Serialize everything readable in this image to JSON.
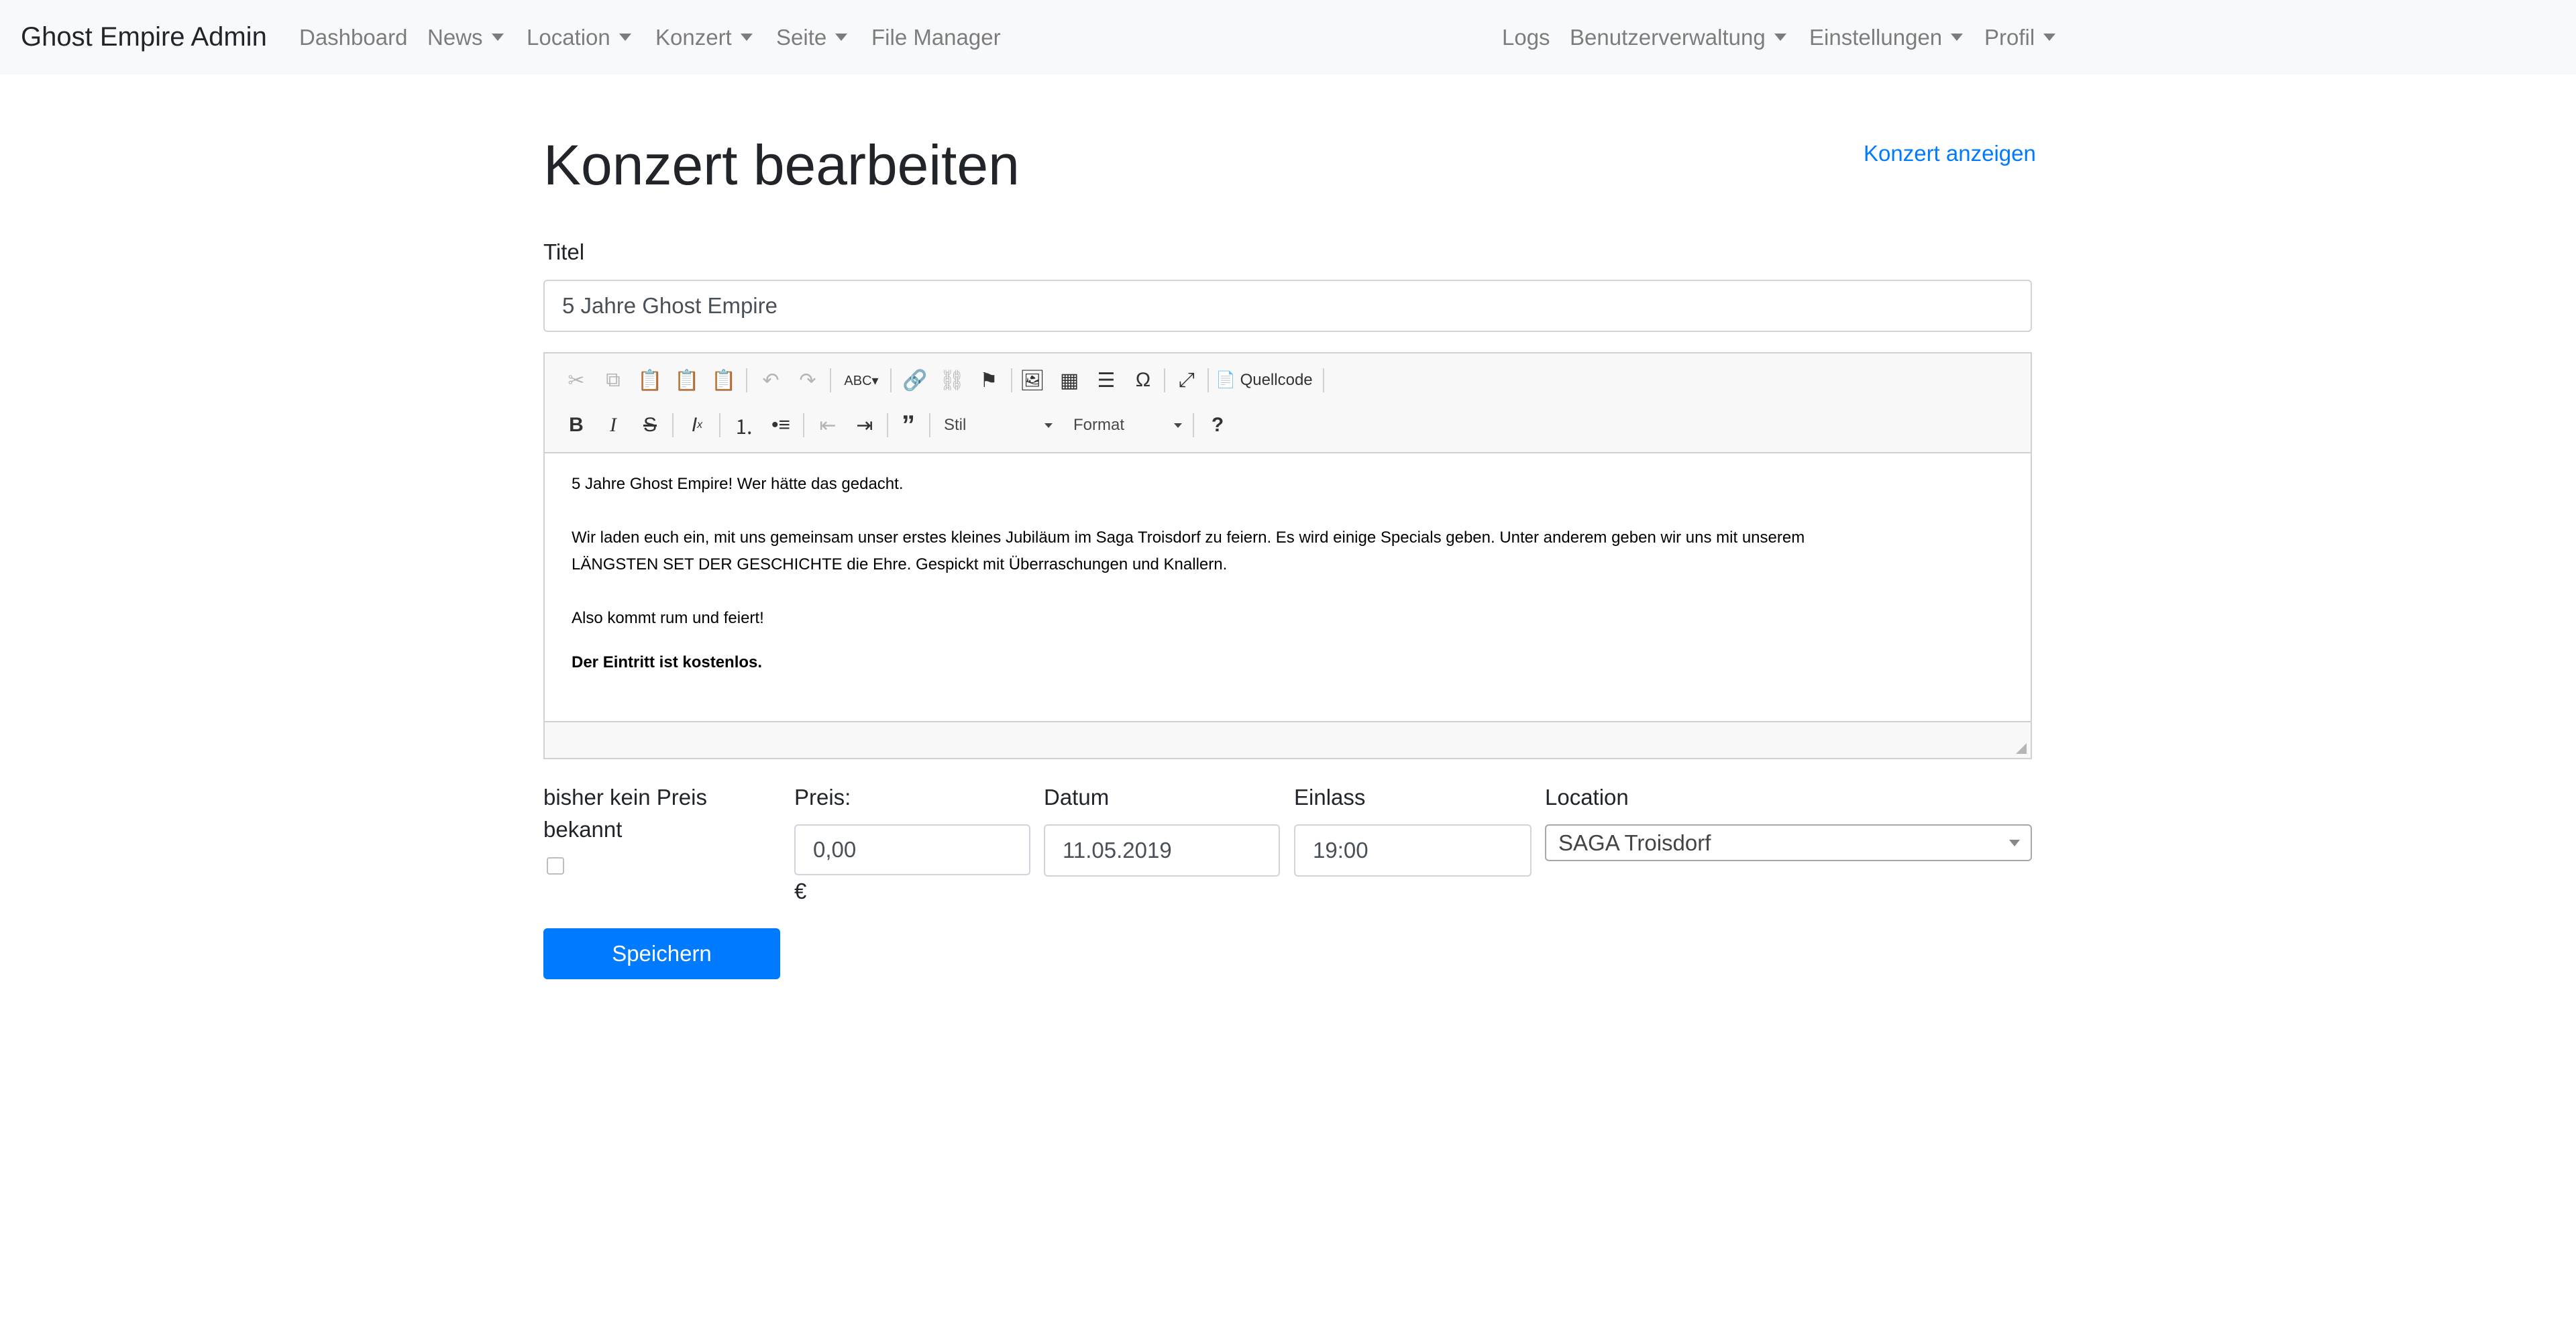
{
  "navbar": {
    "brand": "Ghost Empire Admin",
    "left_items": [
      {
        "label": "Dashboard",
        "dropdown": false
      },
      {
        "label": "News",
        "dropdown": true
      },
      {
        "label": "Location",
        "dropdown": true
      },
      {
        "label": "Konzert",
        "dropdown": true
      },
      {
        "label": "Seite",
        "dropdown": true
      },
      {
        "label": "File Manager",
        "dropdown": false
      }
    ],
    "right_items": [
      {
        "label": "Logs",
        "dropdown": false
      },
      {
        "label": "Benutzerverwaltung",
        "dropdown": true
      },
      {
        "label": "Einstellungen",
        "dropdown": true
      },
      {
        "label": "Profil",
        "dropdown": true
      }
    ]
  },
  "page": {
    "title": "Konzert bearbeiten",
    "view_link": "Konzert anzeigen"
  },
  "form": {
    "title_label": "Titel",
    "title_value": "5 Jahre Ghost Empire",
    "no_price_label_line1": "bisher kein Preis",
    "no_price_label_line2": "bekannt",
    "no_price_checked": false,
    "price_label": "Preis:",
    "price_value": "0,00",
    "currency": "€",
    "date_label": "Datum",
    "date_value": "11.05.2019",
    "admission_label": "Einlass",
    "admission_value": "19:00",
    "location_label": "Location",
    "location_value": "SAGA Troisdorf",
    "save_label": "Speichern"
  },
  "editor": {
    "toolbar": {
      "source_label": "Quellcode",
      "style_combo": "Stil",
      "format_combo": "Format",
      "help_glyph": "?"
    },
    "icons": [
      "cut-icon",
      "copy-icon",
      "paste-icon",
      "paste-text-icon",
      "paste-word-icon",
      "undo-icon",
      "redo-icon",
      "spellcheck-icon",
      "link-icon",
      "unlink-icon",
      "anchor-icon",
      "image-icon",
      "table-icon",
      "horizontal-rule-icon",
      "special-char-icon",
      "maximize-icon",
      "source-icon",
      "bold-icon",
      "italic-icon",
      "strike-icon",
      "remove-format-icon",
      "numbered-list-icon",
      "bulleted-list-icon",
      "outdent-icon",
      "indent-icon",
      "blockquote-icon",
      "help-icon"
    ],
    "content": {
      "p1": "5 Jahre Ghost Empire! Wer hätte das gedacht.",
      "p2_line1": "Wir laden euch ein, mit uns gemeinsam unser erstes kleines Jubiläum im Saga Troisdorf zu feiern. Es wird einige Specials geben. Unter anderem geben wir uns mit unserem",
      "p2_line2": "LÄNGSTEN SET DER GESCHICHTE die Ehre. Gespickt mit Überraschungen und Knallern.",
      "p3": "Also kommt rum und feiert!",
      "p4": "Der Eintritt ist kostenlos."
    }
  }
}
